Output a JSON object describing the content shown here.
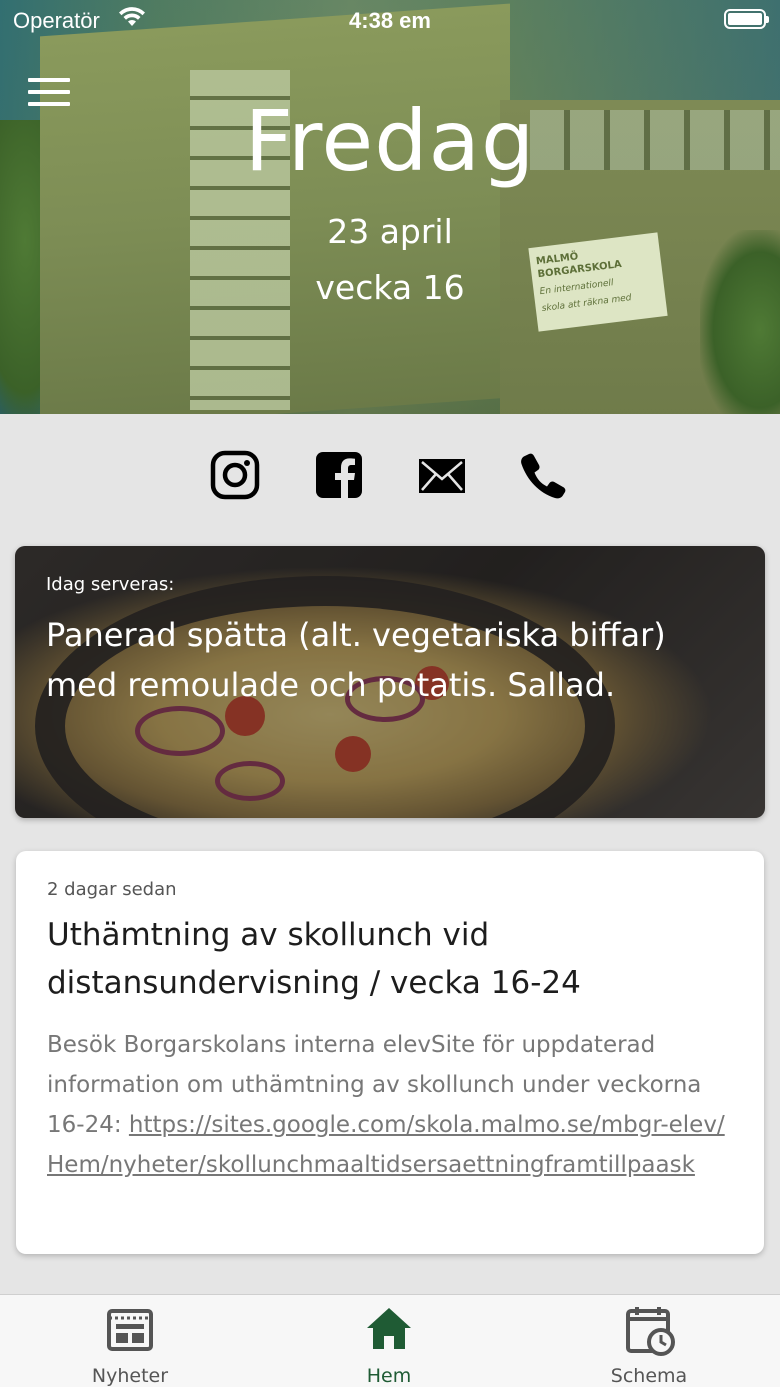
{
  "status_bar": {
    "carrier": "Operatör",
    "time": "4:38 em",
    "battery_level": 1.0
  },
  "hero": {
    "day": "Fredag",
    "date": "23 april",
    "week": "vecka 16",
    "menu_icon": "hamburger-menu-icon"
  },
  "building_sign": {
    "line1": "MALMÖ",
    "line2": "BORGARSKOLA",
    "line3": "En internationell",
    "line4": "skola att räkna med"
  },
  "social": {
    "icons": [
      "instagram-icon",
      "facebook-icon",
      "mail-icon",
      "phone-icon"
    ]
  },
  "lunch": {
    "label": "Idag serveras:",
    "dish": "Panerad spätta (alt. vegetariska biffar) med remoulade och potatis. Sallad."
  },
  "news": {
    "time_ago": "2 dagar sedan",
    "title": "Uthämtning av skollunch vid distansundervisning / vecka 16-24",
    "body_text": "Besök Borgarskolans interna elevSite för uppdaterad information om uthämtning av skollunch under veckorna 16-24: ",
    "link_text": "https://sites.google.com/skola.malmo.se/mbgr-elev/Hem/nyheter/skollunchmaaltidsersaettningframtillpaask"
  },
  "tabs": [
    {
      "label": "Nyheter",
      "icon": "news-icon",
      "active": false
    },
    {
      "label": "Hem",
      "icon": "home-icon",
      "active": true
    },
    {
      "label": "Schema",
      "icon": "schedule-icon",
      "active": false
    }
  ],
  "colors": {
    "accent": "#1f5b34",
    "inactive_tab": "#555555",
    "background": "#e5e5e5"
  }
}
